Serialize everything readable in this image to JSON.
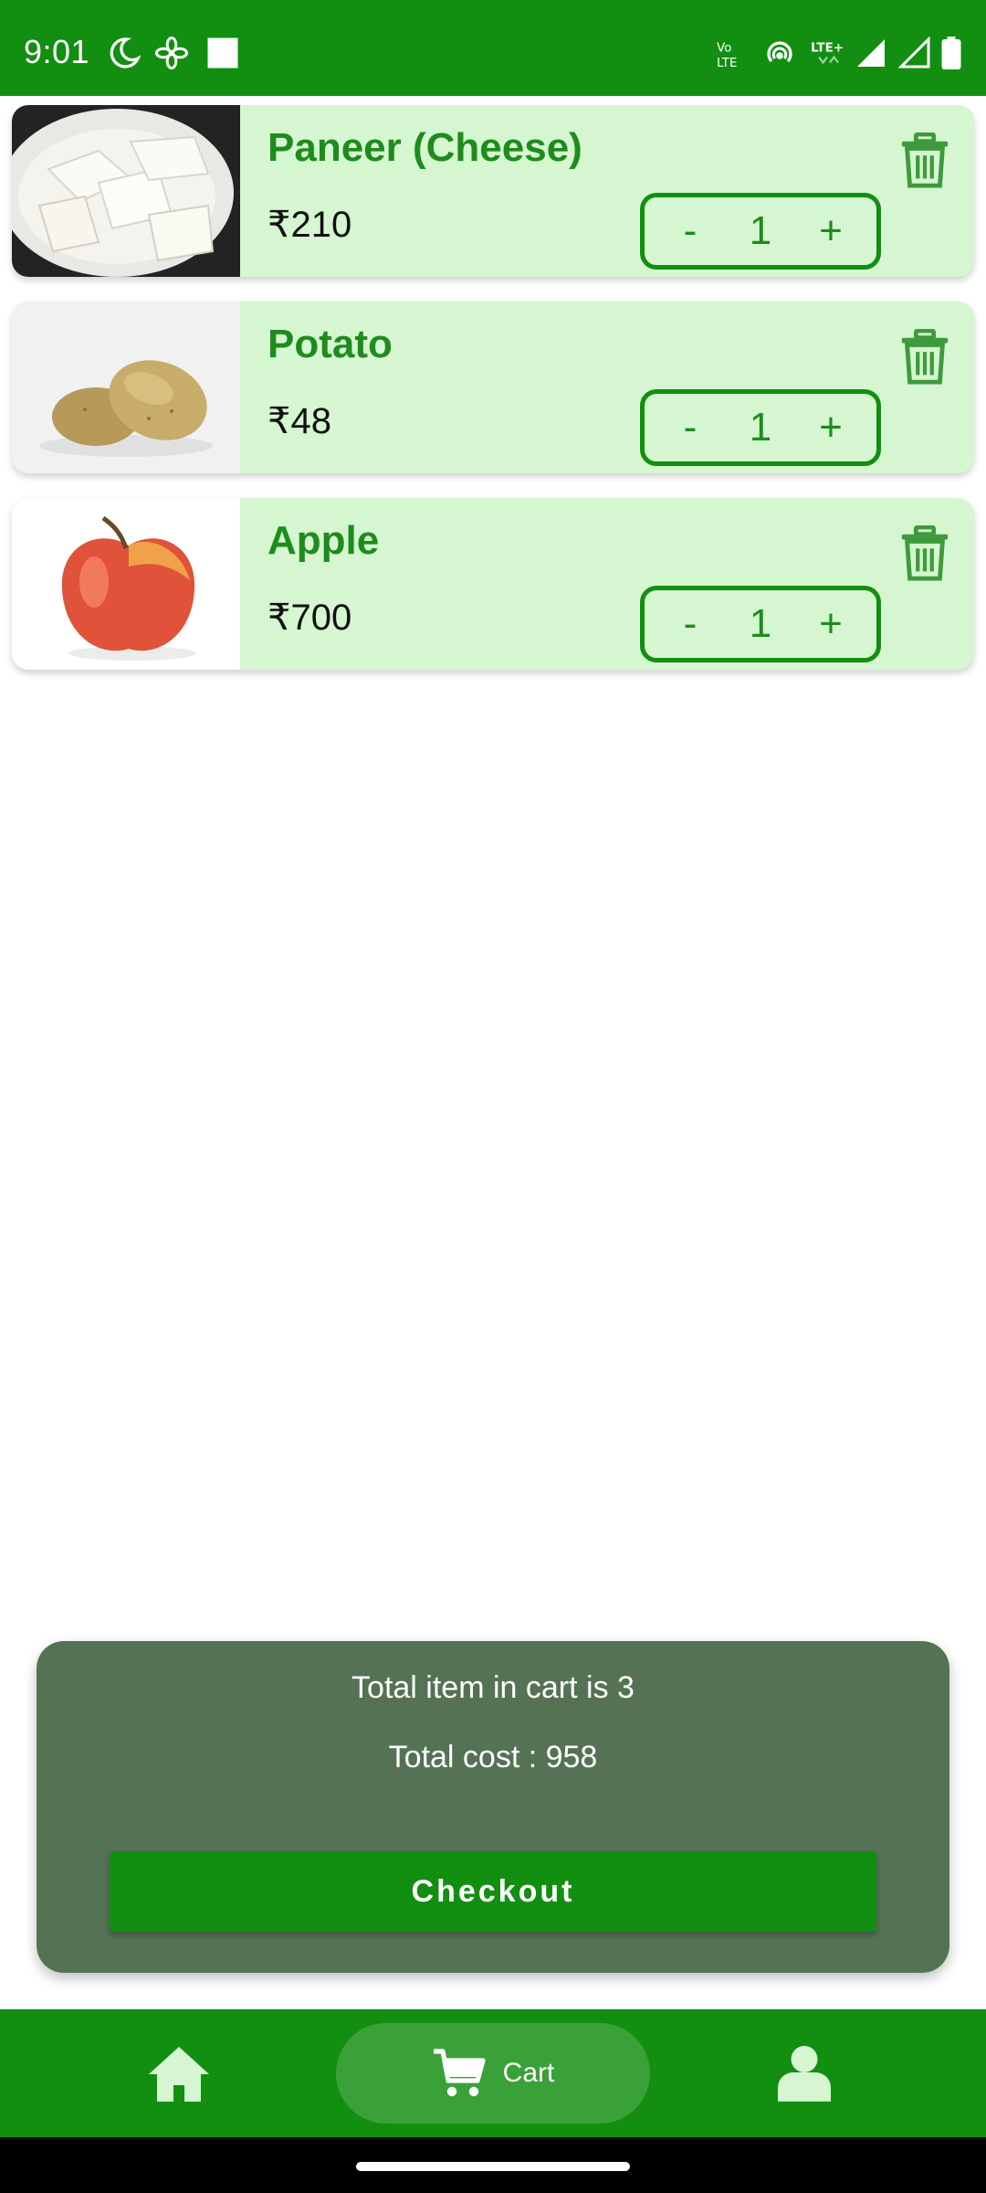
{
  "status_bar": {
    "time": "9:01",
    "icons": [
      "moon-icon",
      "fan-icon",
      "square-icon",
      "volte-icon",
      "hotspot-icon",
      "lte-icon",
      "signal-icon",
      "signal-empty-icon",
      "battery-icon"
    ]
  },
  "cart": {
    "items": [
      {
        "name": "Paneer (Cheese)",
        "price": "₹210",
        "quantity": "1",
        "image": "paneer-image"
      },
      {
        "name": "Potato",
        "price": "₹48",
        "quantity": "1",
        "image": "potato-image"
      },
      {
        "name": "Apple",
        "price": "₹700",
        "quantity": "1",
        "image": "apple-image"
      }
    ],
    "minus_label": "-",
    "plus_label": "+"
  },
  "summary": {
    "items_text": "Total item in cart is 3",
    "cost_text": "Total cost : 958",
    "checkout_label": "Checkout"
  },
  "bottom_nav": {
    "items": [
      {
        "icon": "home-icon"
      },
      {
        "icon": "cart-icon",
        "label": "Cart",
        "active": true
      },
      {
        "icon": "profile-icon"
      }
    ]
  },
  "colors": {
    "primary": "#128f10",
    "card_bg": "#d5f6d0",
    "summary_bg": "#557254",
    "active_pill": "#3aa139"
  }
}
